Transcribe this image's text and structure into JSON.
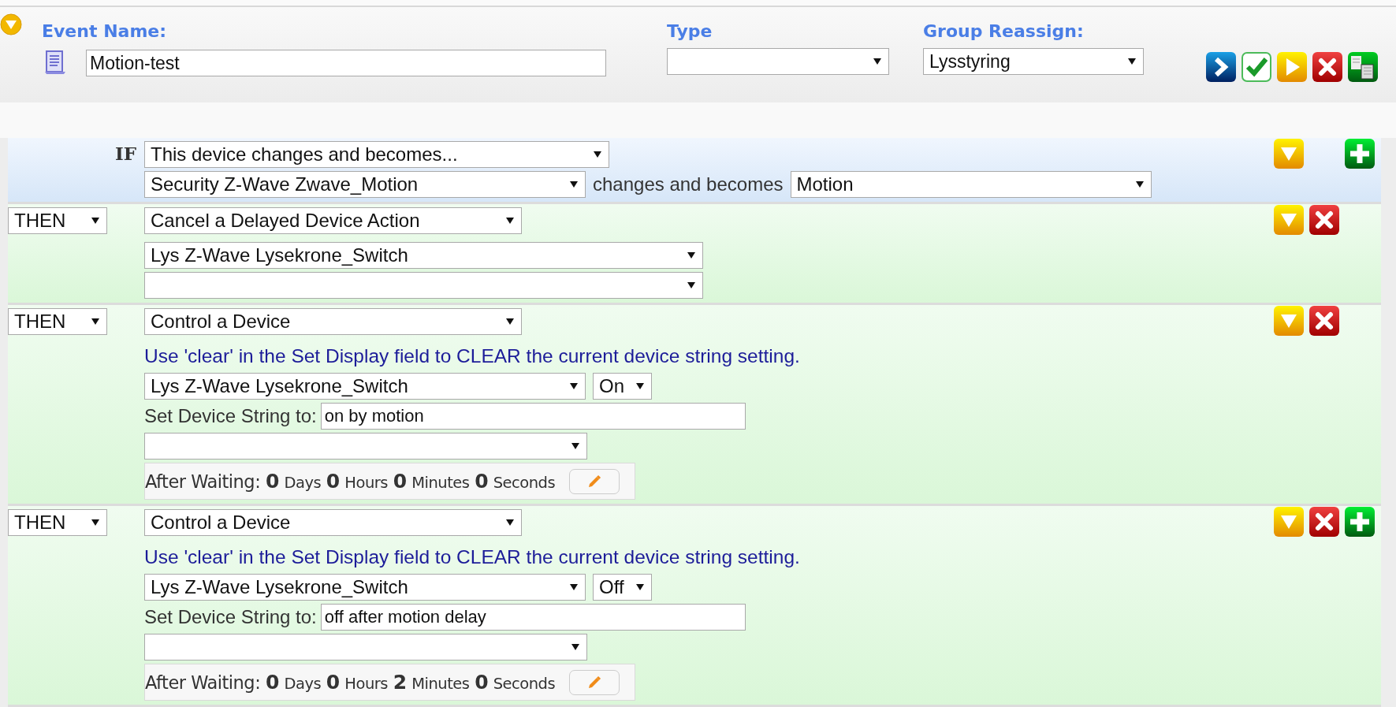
{
  "event_name": {
    "label": "Event Name:",
    "value": "Motion-test"
  },
  "type": {
    "label": "Type"
  },
  "group_reassign": {
    "label": "Group Reassign:",
    "value": "Lysstyring"
  },
  "condition": {
    "keyword": "IF",
    "trigger": "This device changes and becomes...",
    "device": "Security Z-Wave Zwave_Motion",
    "connector": "changes and becomes",
    "state": "Motion",
    "can_delete": false,
    "can_add": true
  },
  "actions": [
    {
      "kind": "cancel",
      "keyword": "THEN",
      "action": "Cancel a Delayed Device Action",
      "device": "Lys Z-Wave Lysekrone_Switch",
      "can_delete": true,
      "can_add": false
    },
    {
      "kind": "control",
      "keyword": "THEN",
      "action": "Control a Device",
      "note": "Use 'clear' in the Set Display field to CLEAR the current device string setting.",
      "device": "Lys Z-Wave Lysekrone_Switch",
      "command": "On",
      "string_label": "Set Device String to:",
      "string_value": "on by motion",
      "wait": {
        "label": "After Waiting:",
        "parts": [
          {
            "value": "0",
            "unit": "Days"
          },
          {
            "value": "0",
            "unit": "Hours"
          },
          {
            "value": "0",
            "unit": "Minutes"
          },
          {
            "value": "0",
            "unit": "Seconds"
          }
        ]
      },
      "can_delete": true,
      "can_add": false
    },
    {
      "kind": "control",
      "keyword": "THEN",
      "action": "Control a Device",
      "note": "Use 'clear' in the Set Display field to CLEAR the current device string setting.",
      "device": "Lys Z-Wave Lysekrone_Switch",
      "command": "Off",
      "string_label": "Set Device String to:",
      "string_value": "off after motion delay",
      "wait": {
        "label": "After Waiting:",
        "parts": [
          {
            "value": "0",
            "unit": "Days"
          },
          {
            "value": "0",
            "unit": "Hours"
          },
          {
            "value": "2",
            "unit": "Minutes"
          },
          {
            "value": "0",
            "unit": "Seconds"
          }
        ]
      },
      "can_delete": true,
      "can_add": true
    }
  ]
}
